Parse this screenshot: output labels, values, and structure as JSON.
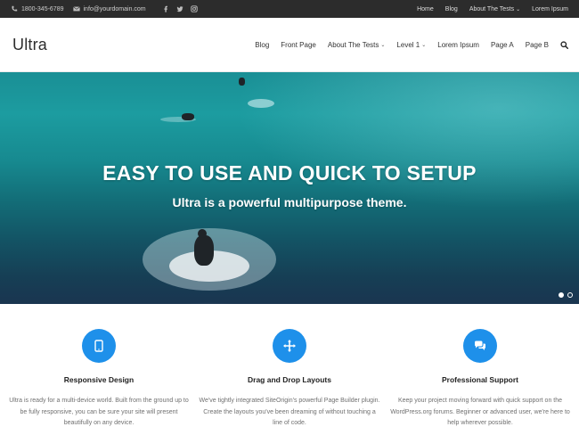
{
  "topbar": {
    "phone": "1800-345-6789",
    "email": "info@yourdomain.com",
    "social": [
      "facebook-icon",
      "twitter-icon",
      "instagram-icon"
    ],
    "links": [
      "Home",
      "Blog",
      "About The Tests",
      "Lorem Ipsum"
    ]
  },
  "header": {
    "logo": "Ultra",
    "nav": [
      "Blog",
      "Front Page",
      "About The Tests",
      "Level 1",
      "Lorem Ipsum",
      "Page A",
      "Page B"
    ]
  },
  "hero": {
    "title": "EASY TO USE AND QUICK TO SETUP",
    "subtitle": "Ultra is a powerful multipurpose theme.",
    "slides": 2,
    "active_slide": 1
  },
  "features": [
    {
      "icon": "tablet-icon",
      "title": "Responsive Design",
      "text": "Ultra is ready for a multi-device world. Built from the ground up to be fully responsive, you can be sure your site will present beautifully on any device."
    },
    {
      "icon": "move-arrows-icon",
      "title": "Drag and Drop Layouts",
      "text": "We've tightly integrated SiteOrigin's powerful Page Builder plugin. Create the layouts you've been dreaming of without touching a line of code."
    },
    {
      "icon": "chat-bubbles-icon",
      "title": "Professional Support",
      "text": "Keep your project moving forward with quick support on the WordPress.org forums. Beginner or advanced user, we're here to help wherever possible."
    }
  ],
  "colors": {
    "accent": "#1e90ea",
    "topbar": "#2c2c2c",
    "sea": "#1a8f95"
  }
}
